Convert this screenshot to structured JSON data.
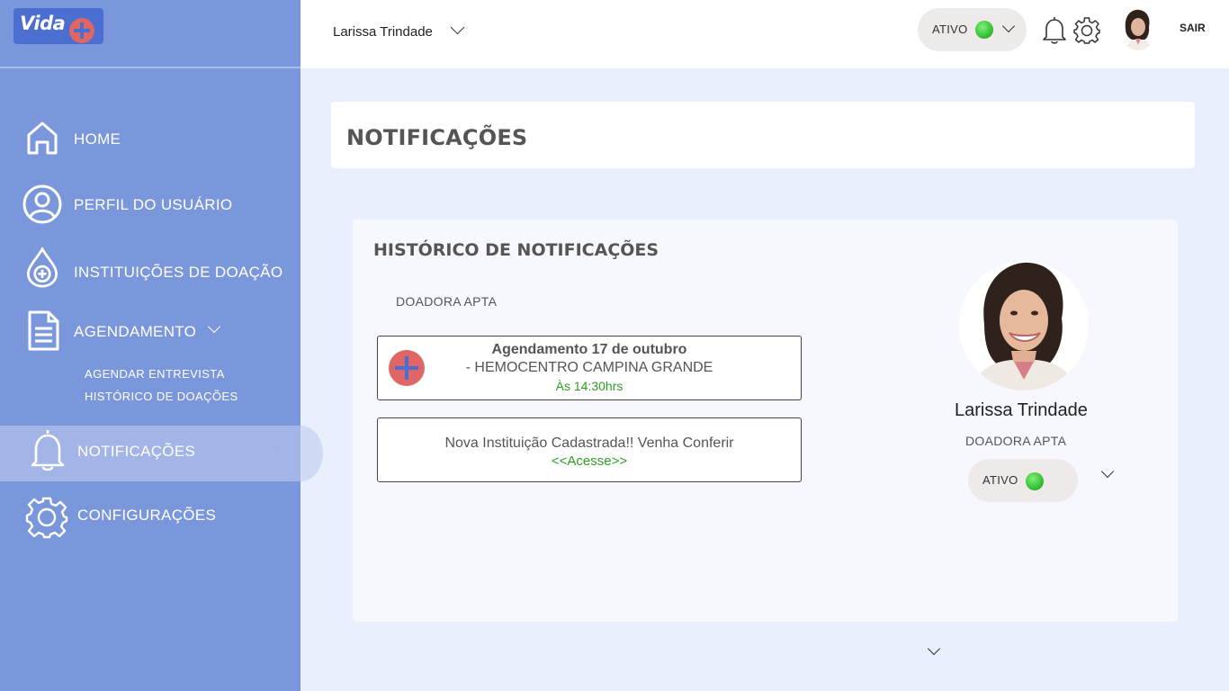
{
  "app": {
    "logo_text": "Vida"
  },
  "sidebar": {
    "items": [
      {
        "label": "HOME",
        "icon": "home-icon"
      },
      {
        "label": "PERFIL DO USUÁRIO",
        "icon": "user-icon"
      },
      {
        "label": "INSTITUIÇÕES DE DOAÇÃO",
        "icon": "blood-drop-icon"
      },
      {
        "label": "AGENDAMENTO",
        "icon": "document-icon"
      },
      {
        "label": "NOTIFICAÇÕES",
        "icon": "bell-icon",
        "active": true
      },
      {
        "label": "CONFIGURAÇÕES",
        "icon": "gear-icon"
      }
    ],
    "subitems": [
      "AGENDAR ENTREVISTA",
      "HISTÓRICO DE DOAÇÕES"
    ]
  },
  "topbar": {
    "user_name": "Larissa Trindade",
    "status": "ATIVO",
    "logout": "SAIR"
  },
  "page": {
    "title": "NOTIFICAÇÕES"
  },
  "history": {
    "title": "HISTÓRICO DE NOTIFICAÇÕES",
    "subtitle": "DOADORA APTA",
    "notifications": [
      {
        "title": "Agendamento 17 de outubro",
        "detail": "- HEMOCENTRO CAMPINA GRANDE",
        "time": "Às 14:30hrs"
      },
      {
        "title": "Nova Instituição Cadastrada!! Venha Conferir",
        "link": "<<Acesse>>"
      }
    ]
  },
  "profile": {
    "name": "Larissa Trindade",
    "role": "DOADORA APTA",
    "status": "ATIVO"
  },
  "colors": {
    "sidebar": "#7b97db",
    "sidebar_active": "#a3b4e6",
    "accent_red": "#e06666",
    "accent_blue": "#4b6fd1",
    "status_green": "#2bb82a",
    "background": "#e9effc"
  }
}
